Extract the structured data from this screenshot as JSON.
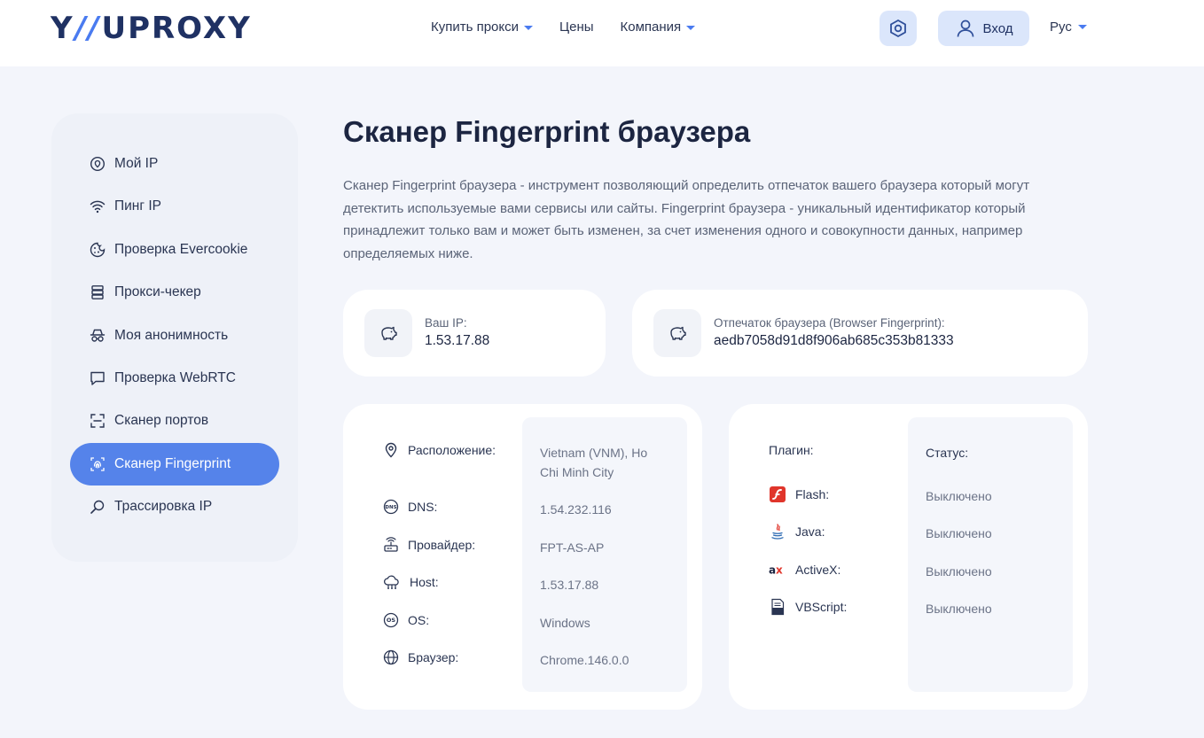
{
  "header": {
    "logo_left": "Y",
    "logo_mark": "//",
    "logo_right": "UPROXY",
    "nav": [
      {
        "label": "Купить прокси",
        "has_caret": true
      },
      {
        "label": "Цены",
        "has_caret": false
      },
      {
        "label": "Компания",
        "has_caret": true
      }
    ],
    "login_label": "Вход",
    "language": "Рус"
  },
  "sidebar": {
    "items": [
      {
        "label": "Мой IP",
        "icon": "map-pin-icon"
      },
      {
        "label": "Пинг IP",
        "icon": "wifi-icon"
      },
      {
        "label": "Проверка Evercookie",
        "icon": "cookie-icon"
      },
      {
        "label": "Прокси-чекер",
        "icon": "server-icon"
      },
      {
        "label": "Моя анонимность",
        "icon": "incognito-icon"
      },
      {
        "label": "Проверка WebRTC",
        "icon": "chat-icon"
      },
      {
        "label": "Сканер портов",
        "icon": "scan-icon"
      },
      {
        "label": "Сканер Fingerprint",
        "icon": "fingerprint-icon",
        "active": true
      },
      {
        "label": "Трассировка IP",
        "icon": "trace-icon"
      }
    ]
  },
  "main": {
    "title": "Сканер Fingerprint браузера",
    "intro": "Сканер Fingerprint браузера - инструмент позволяющий определить отпечаток вашего браузера который могут детектить используемые вами сервисы или сайты. Fingerprint браузера - уникальный идентификатор который принадлежит только вам и может быть изменен, за счет изменения одного и совокупности данных, например определяемых ниже.",
    "ip_card": {
      "label": "Ваш IP:",
      "value": "1.53.17.88"
    },
    "fingerprint_card": {
      "label": "Отпечаток браузера (Browser Fingerprint):",
      "value": "aedb7058d91d8f906ab685c353b81333"
    },
    "info_rows": [
      {
        "label": "Расположение:",
        "value": "Vietnam (VNM), Ho Chi Minh City",
        "icon": "location-icon"
      },
      {
        "label": "DNS:",
        "value": "1.54.232.116",
        "icon": "dns-icon"
      },
      {
        "label": "Провайдер:",
        "value": "FPT-AS-AP",
        "icon": "router-icon"
      },
      {
        "label": "Host:",
        "value": "1.53.17.88",
        "icon": "cloud-icon"
      },
      {
        "label": "OS:",
        "value": "Windows",
        "icon": "os-icon"
      },
      {
        "label": "Браузер:",
        "value": "Chrome.146.0.0",
        "icon": "globe-icon"
      }
    ],
    "plugins": {
      "plugin_header": "Плагин:",
      "status_header": "Статус:",
      "rows": [
        {
          "label": "Flash:",
          "status": "Выключено",
          "icon": "flash-icon"
        },
        {
          "label": "Java:",
          "status": "Выключено",
          "icon": "java-icon"
        },
        {
          "label": "ActiveX:",
          "status": "Выключено",
          "icon": "activex-icon"
        },
        {
          "label": "VBScript:",
          "status": "Выключено",
          "icon": "vbscript-icon"
        }
      ]
    }
  },
  "colors": {
    "accent": "#5583ea",
    "button_bg": "#dbe6fb",
    "logo": "#1f3163",
    "text": "#1c2541"
  }
}
